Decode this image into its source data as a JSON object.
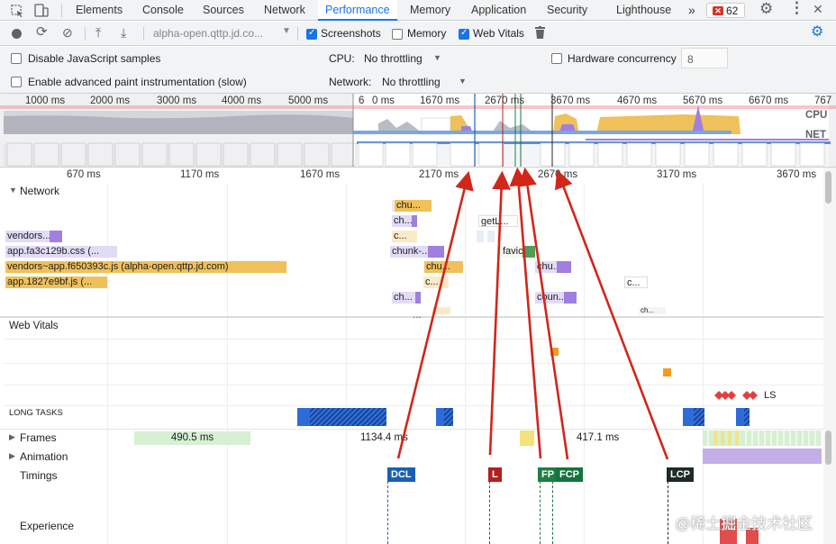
{
  "tabs": [
    "Elements",
    "Console",
    "Sources",
    "Network",
    "Performance",
    "Memory",
    "Application",
    "Security",
    "Lighthouse"
  ],
  "active_tab": "Performance",
  "more_tabs": "»",
  "error_count": "62",
  "toolbar": {
    "url": "alpha-open.qttp.jd.co...",
    "screenshots": "Screenshots",
    "memory": "Memory",
    "web_vitals": "Web Vitals"
  },
  "settings": {
    "disable_js": "Disable JavaScript samples",
    "advanced_paint": "Enable advanced paint instrumentation (slow)",
    "cpu_label": "CPU:",
    "cpu_value": "No throttling",
    "network_label": "Network:",
    "network_value": "No throttling",
    "hw_label": "Hardware concurrency",
    "hw_value": "8"
  },
  "overview": {
    "ticks": [
      "1000 ms",
      "2000 ms",
      "3000 ms",
      "4000 ms",
      "5000 ms",
      "6",
      "0 ms",
      "1670 ms",
      "2670 ms",
      "3670 ms",
      "4670 ms",
      "5670 ms",
      "6670 ms",
      "767"
    ],
    "cpu": "CPU",
    "net": "NET"
  },
  "main_ticks": [
    "670 ms",
    "1170 ms",
    "1670 ms",
    "2170 ms",
    "2670 ms",
    "3170 ms",
    "3670 ms"
  ],
  "network": {
    "title": "Network",
    "bars": [
      "chu...",
      "ch...",
      "c...",
      "chunk-...",
      "ch...",
      "vendors...",
      "app.fa3c129b.css (...",
      "vendors~app.f650393c.js (alpha-open.qttp.jd.com)",
      "app.1827e9bf.js (...",
      "getL...",
      "favic...",
      "chu...",
      "chu...",
      "c...",
      "c...",
      "coun...",
      "ch..."
    ],
    "ellipsis": "..."
  },
  "web_vitals": {
    "title": "Web Vitals",
    "ls": "LS",
    "long_tasks": "LONG TASKS"
  },
  "tracks": {
    "frames": "Frames",
    "animation": "Animation",
    "timings": "Timings",
    "experience": "Experience",
    "frame_times": [
      "490.5 ms",
      "1134.4 ms",
      "417.1 ms"
    ]
  },
  "markers": [
    "DCL",
    "L",
    "FP",
    "FCP",
    "LCP"
  ],
  "watermark": "@稀土掘金技术社区",
  "colors": {
    "accent": "#1a73e8",
    "dcl": "#1a5fb4",
    "l": "#b1201e",
    "fp": "#1e7e44",
    "fcp": "#14743c",
    "lcp": "#1d2b24",
    "arrow": "#d2261a",
    "script": "#f0c05a",
    "style": "#9f7fe0"
  }
}
